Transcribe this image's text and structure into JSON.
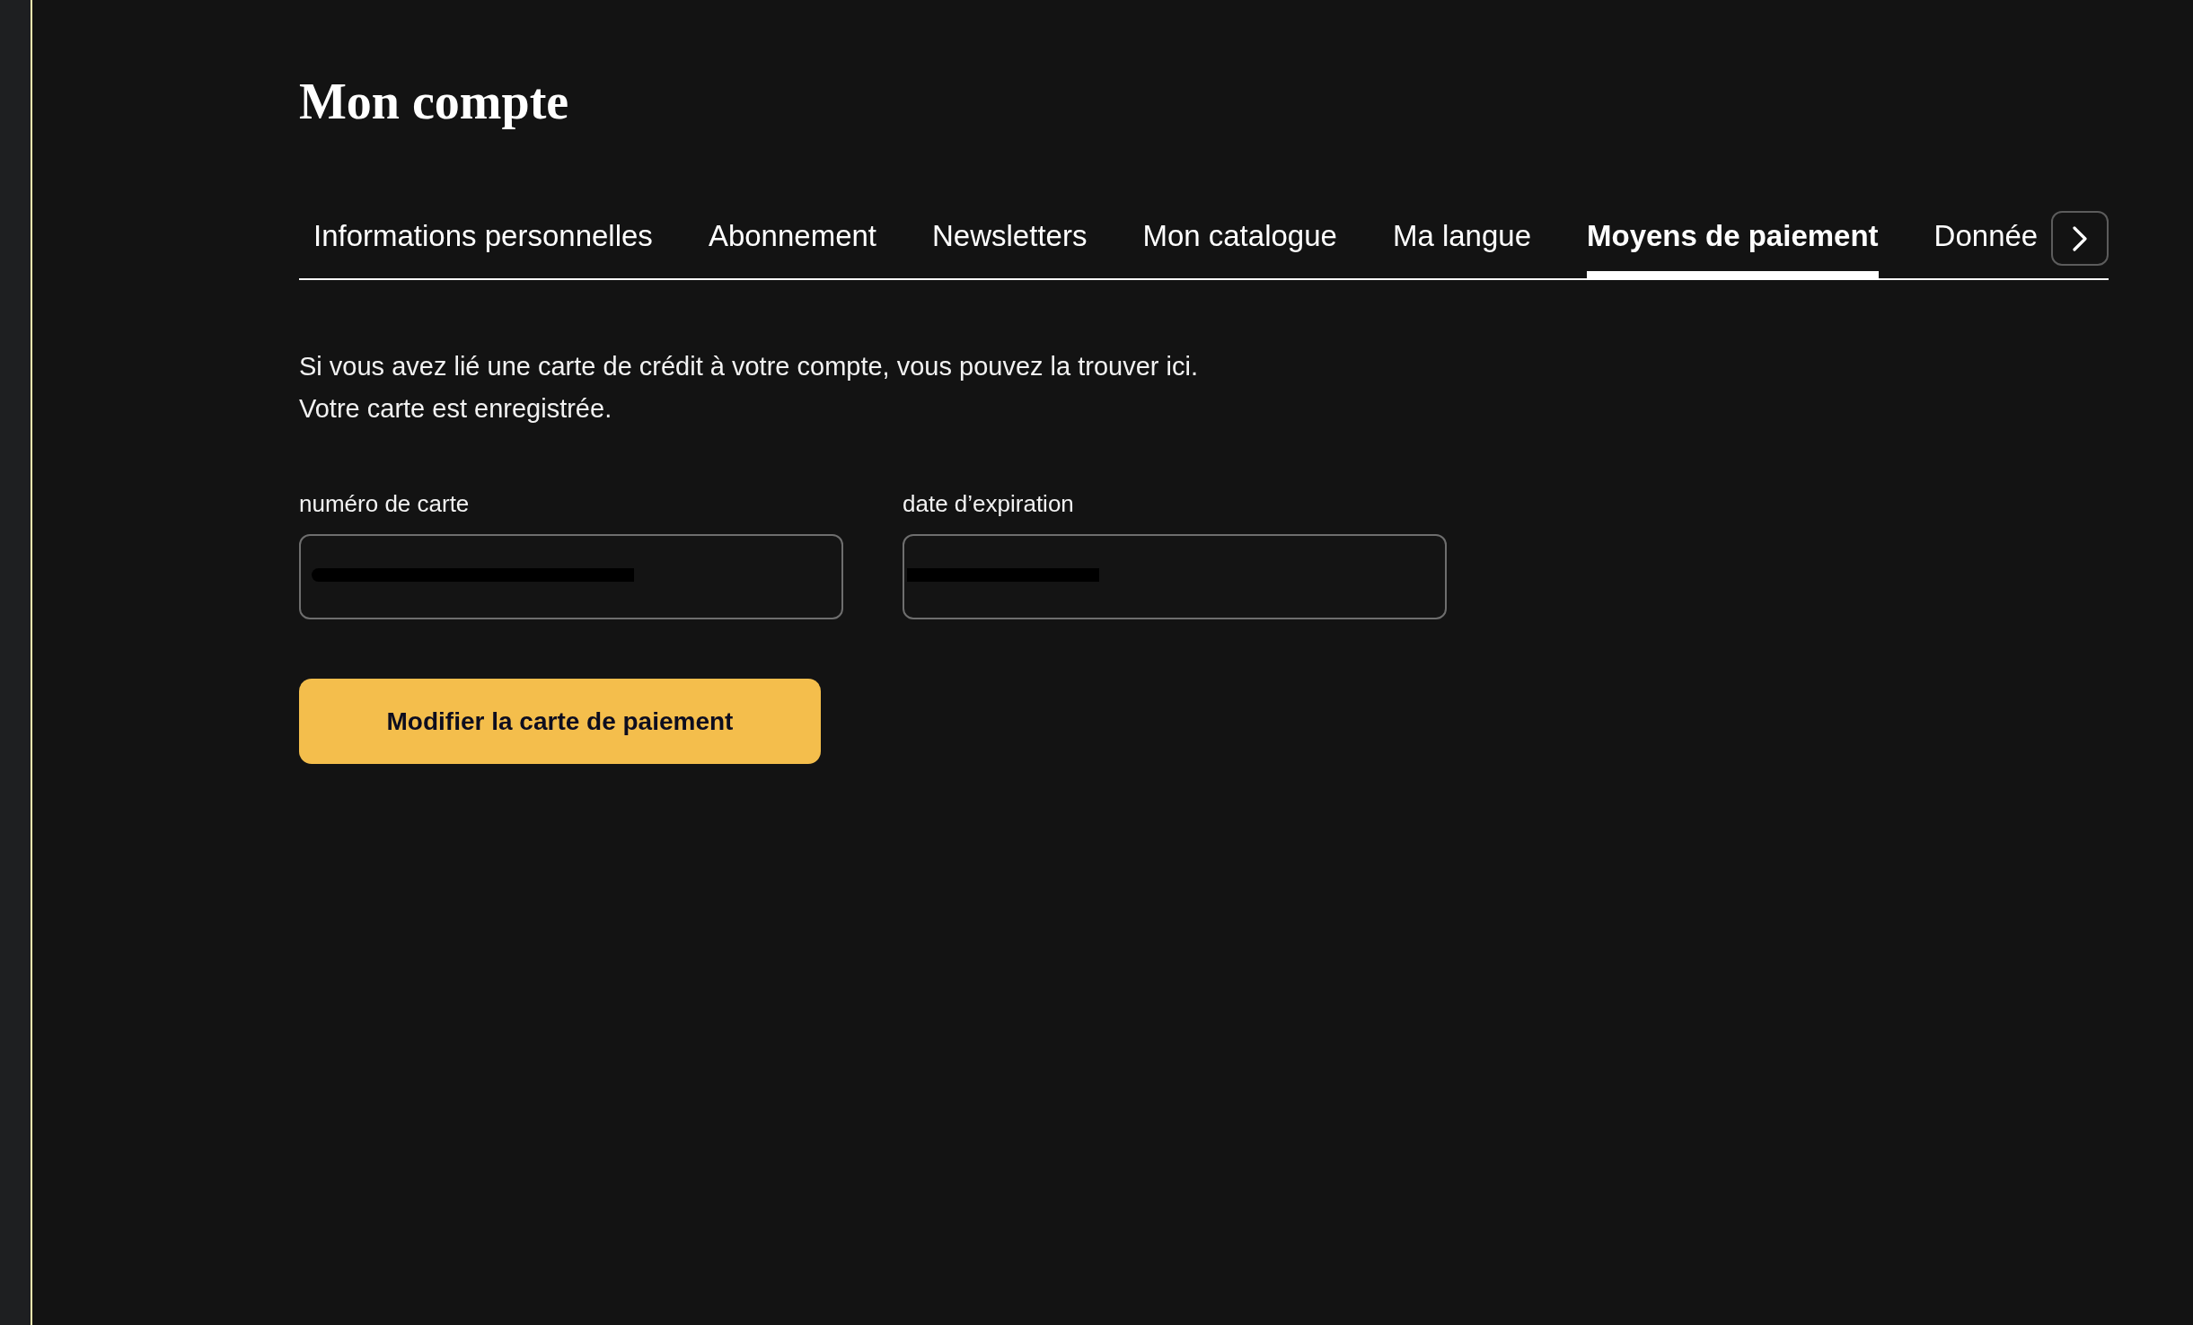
{
  "page": {
    "title": "Mon compte"
  },
  "tabs": [
    {
      "label": "Informations personnelles",
      "selected": false
    },
    {
      "label": "Abonnement",
      "selected": false
    },
    {
      "label": "Newsletters",
      "selected": false
    },
    {
      "label": "Mon catalogue",
      "selected": false
    },
    {
      "label": "Ma langue",
      "selected": false
    },
    {
      "label": "Moyens de paiement",
      "selected": true
    },
    {
      "label": "Donnée",
      "selected": false
    }
  ],
  "paragraphs": [
    "Si vous avez lié une carte de crédit à votre compte, vous pouvez la trouver ici.",
    "Votre carte est enregistrée."
  ],
  "fields": [
    {
      "label": "numéro de carte",
      "redacted": true
    },
    {
      "label": "date d’expiration",
      "redacted": true
    }
  ],
  "button": {
    "label": "Modifier la carte de paiement"
  }
}
